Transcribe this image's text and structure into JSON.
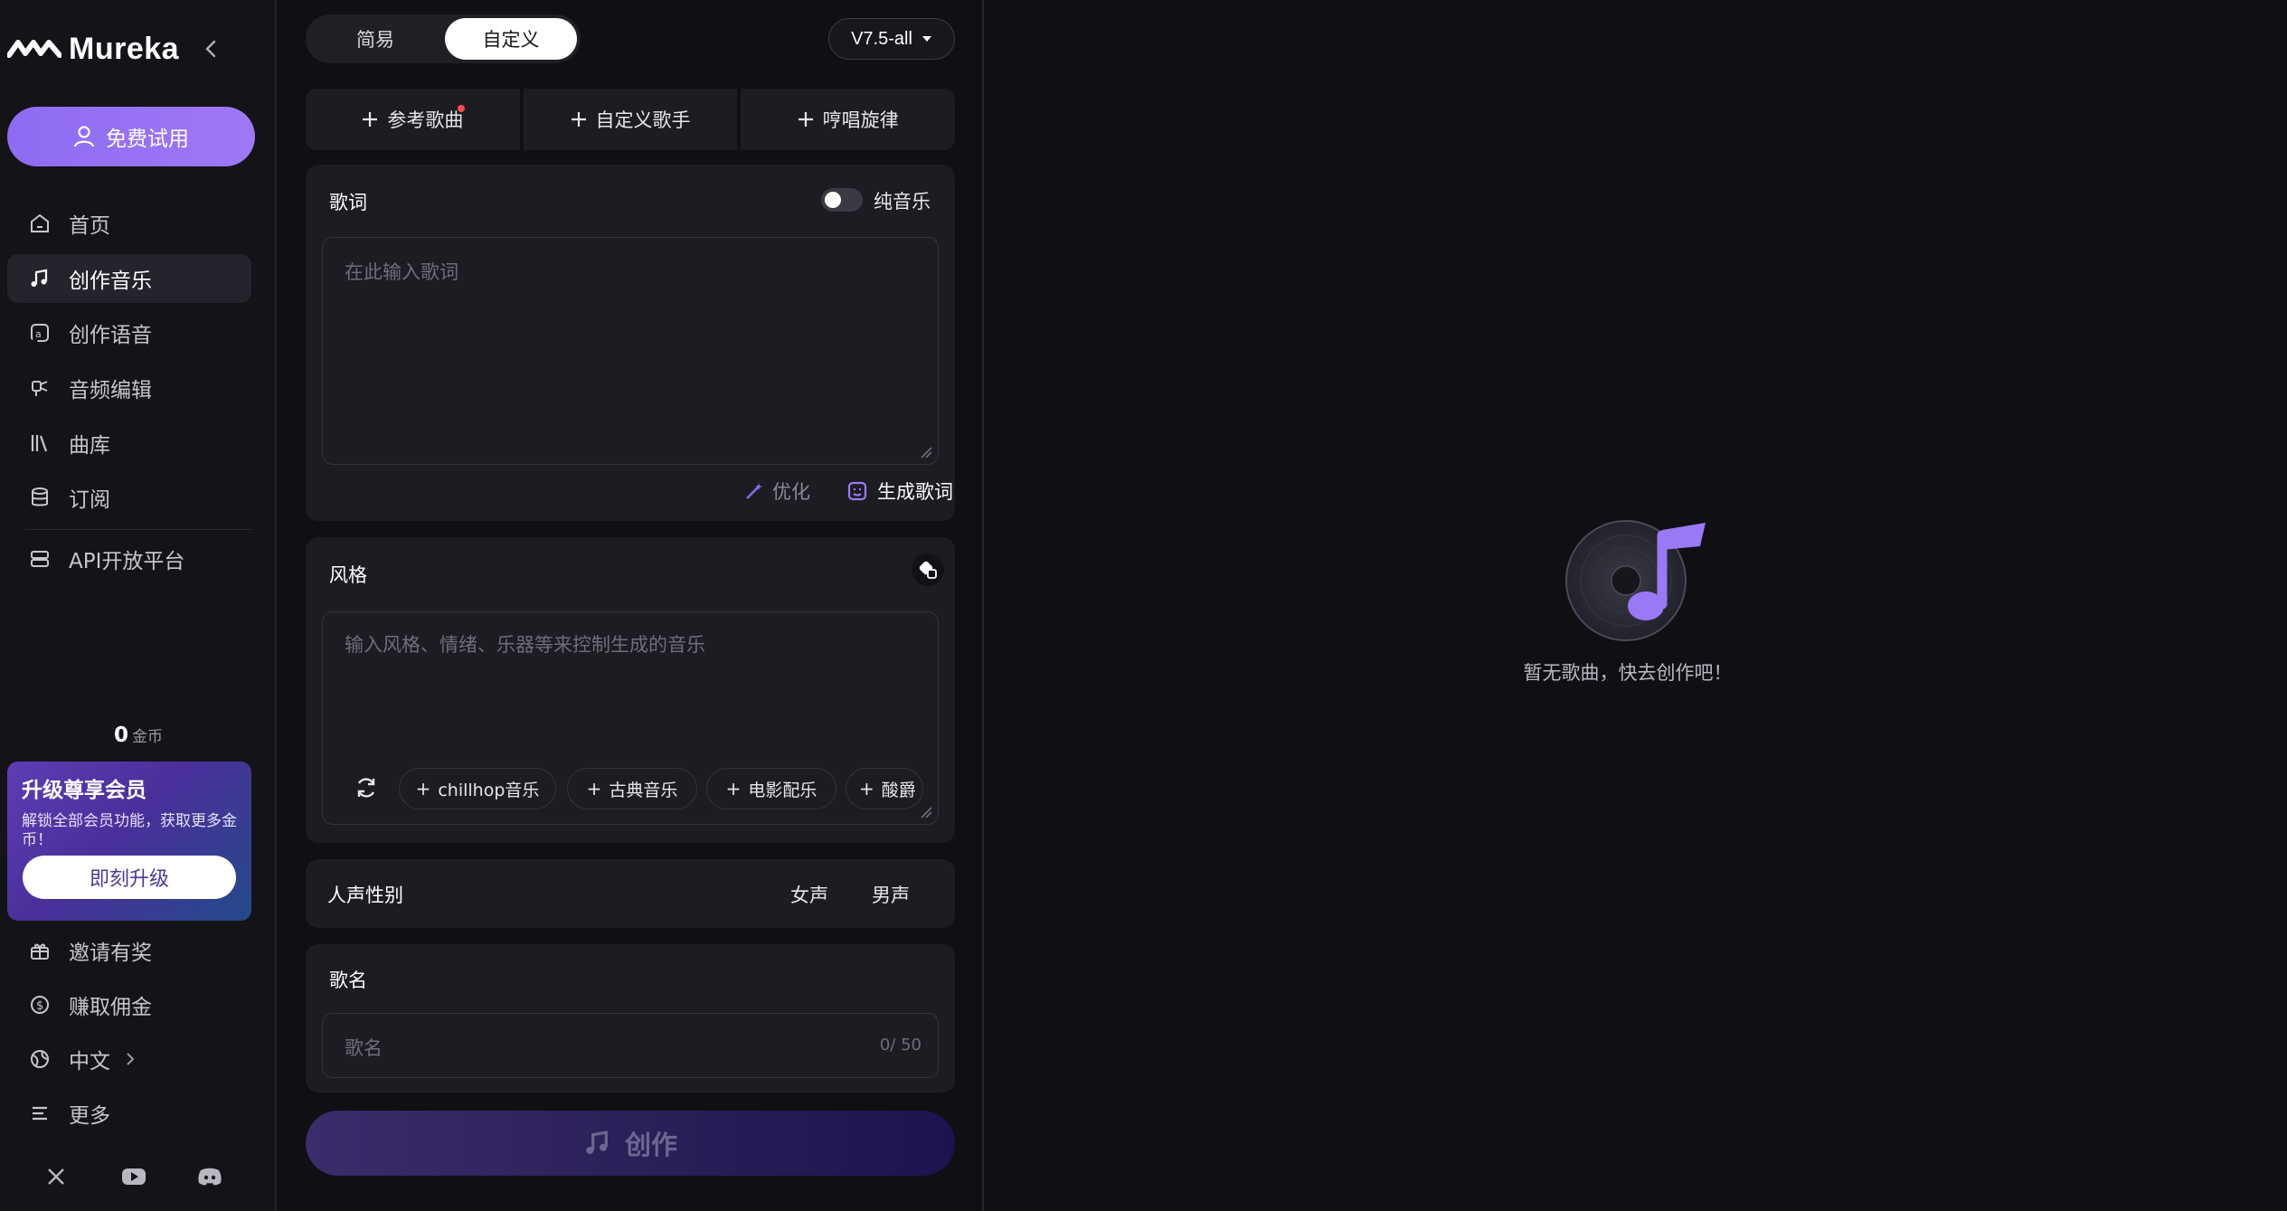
{
  "brand": {
    "name": "Mureka",
    "accent": "#9b78f5"
  },
  "sidebar": {
    "trial_label": "免费试用",
    "nav": [
      {
        "label": "首页",
        "icon": "home-icon"
      },
      {
        "label": "创作音乐",
        "icon": "music-note-icon",
        "active": true
      },
      {
        "label": "创作语音",
        "icon": "voice-icon"
      },
      {
        "label": "音频编辑",
        "icon": "audio-edit-icon"
      },
      {
        "label": "曲库",
        "icon": "library-icon"
      },
      {
        "label": "订阅",
        "icon": "database-icon"
      },
      {
        "label": "API开放平台",
        "icon": "api-icon"
      }
    ],
    "coins": {
      "amount": "0",
      "unit": "金币"
    },
    "upgrade": {
      "title": "升级尊享会员",
      "desc": "解锁全部会员功能，获取更多金币！",
      "button": "即刻升级"
    },
    "bottom_nav": [
      {
        "label": "邀请有奖",
        "icon": "gift-icon"
      },
      {
        "label": "赚取佣金",
        "icon": "dollar-icon"
      },
      {
        "label": "中文",
        "icon": "globe-icon"
      },
      {
        "label": "更多",
        "icon": "menu-icon"
      }
    ],
    "social": [
      "x-icon",
      "youtube-icon",
      "discord-icon"
    ]
  },
  "panel": {
    "mode_tabs": [
      "简易",
      "自定义"
    ],
    "mode_selected": "自定义",
    "version": "V7.5-all",
    "add_buttons": [
      "参考歌曲",
      "自定义歌手",
      "哼唱旋律"
    ],
    "lyrics": {
      "title": "歌词",
      "instrumental_label": "纯音乐",
      "instrumental_on": false,
      "placeholder": "在此输入歌词",
      "optimize_label": "优化",
      "generate_label": "生成歌词"
    },
    "style": {
      "title": "风格",
      "placeholder": "输入风格、情绪、乐器等来控制生成的音乐",
      "chips": [
        "chillhop音乐",
        "古典音乐",
        "电影配乐",
        "酸爵"
      ]
    },
    "voice": {
      "title": "人声性别",
      "options": [
        "女声",
        "男声"
      ]
    },
    "song_name": {
      "title": "歌名",
      "placeholder": "歌名",
      "counter": "0/ 50"
    },
    "create_label": "创作"
  },
  "empty_state": {
    "text": "暂无歌曲，快去创作吧！"
  }
}
